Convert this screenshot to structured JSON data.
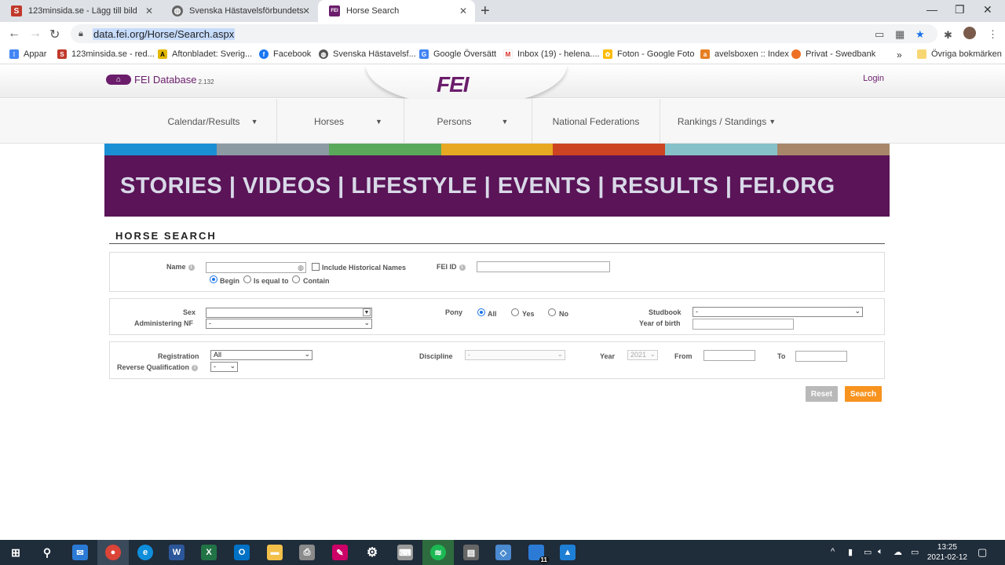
{
  "browser": {
    "tabs": [
      {
        "title": "123minsida.se - Lägg till bild",
        "icon": "s-icon",
        "color": "#c0392b"
      },
      {
        "title": "Svenska Hästavelsförbundets web",
        "icon": "globe-icon",
        "color": "#555555"
      },
      {
        "title": "Horse Search",
        "icon": "fei-icon",
        "color": "#6b1d6b"
      }
    ],
    "url": "data.fei.org/Horse/Search.aspx",
    "bookmarks": [
      {
        "label": "Appar",
        "icon": "apps-icon"
      },
      {
        "label": "123minsida.se - red...",
        "icon": "s-icon"
      },
      {
        "label": "Aftonbladet: Sverig...",
        "icon": "aftonbladet-icon"
      },
      {
        "label": "Facebook",
        "icon": "facebook-icon"
      },
      {
        "label": "Svenska Hästavelsf...",
        "icon": "globe-icon"
      },
      {
        "label": "Google Översätt",
        "icon": "translate-icon"
      },
      {
        "label": "Inbox (19) - helena....",
        "icon": "gmail-icon"
      },
      {
        "label": "Foton - Google Foto",
        "icon": "photos-icon"
      },
      {
        "label": "avelsboxen :: Index",
        "icon": "avelsboxen-icon"
      },
      {
        "label": "Privat - Swedbank",
        "icon": "swedbank-icon"
      }
    ],
    "bookmarks_more": "»",
    "other_bookmarks": "Övriga bokmärken"
  },
  "fei": {
    "db_label": "FEI Database",
    "db_version": "2.132",
    "logo": "FEI",
    "login": "Login",
    "nav": [
      "Calendar/Results",
      "Horses",
      "Persons",
      "National Federations",
      "Rankings / Standings"
    ],
    "colors": [
      "#1a8fd4",
      "#8c9aa3",
      "#5aa85a",
      "#e8a922",
      "#cc4422",
      "#86c1c9",
      "#a8866a"
    ],
    "banner": "STORIES | VIDEOS | LIFESTYLE | EVENTS | RESULTS | FEI.ORG"
  },
  "search": {
    "title": "HORSE SEARCH",
    "name_label": "Name",
    "include_historical": "Include Historical Names",
    "match_options": [
      "Begin",
      "Is equal to",
      "Contain"
    ],
    "feiid_label": "FEI ID",
    "sex_label": "Sex",
    "admin_nf_label": "Administering NF",
    "admin_nf_value": "-",
    "pony_label": "Pony",
    "pony_options": [
      "All",
      "Yes",
      "No"
    ],
    "studbook_label": "Studbook",
    "studbook_value": "-",
    "year_of_birth_label": "Year of birth",
    "registration_label": "Registration",
    "registration_value": "All",
    "reverse_qual_label": "Reverse Qualification",
    "reverse_qual_value": "-",
    "discipline_label": "Discipline",
    "discipline_value": "-",
    "year_label": "Year",
    "year_value": "2021",
    "from_label": "From",
    "to_label": "To",
    "reset_label": "Reset",
    "search_label": "Search",
    "reset_color": "#b9b9b9",
    "search_color": "#f7931e"
  },
  "taskbar": {
    "time": "13:25",
    "date": "2021-02-12",
    "badge": "11"
  }
}
